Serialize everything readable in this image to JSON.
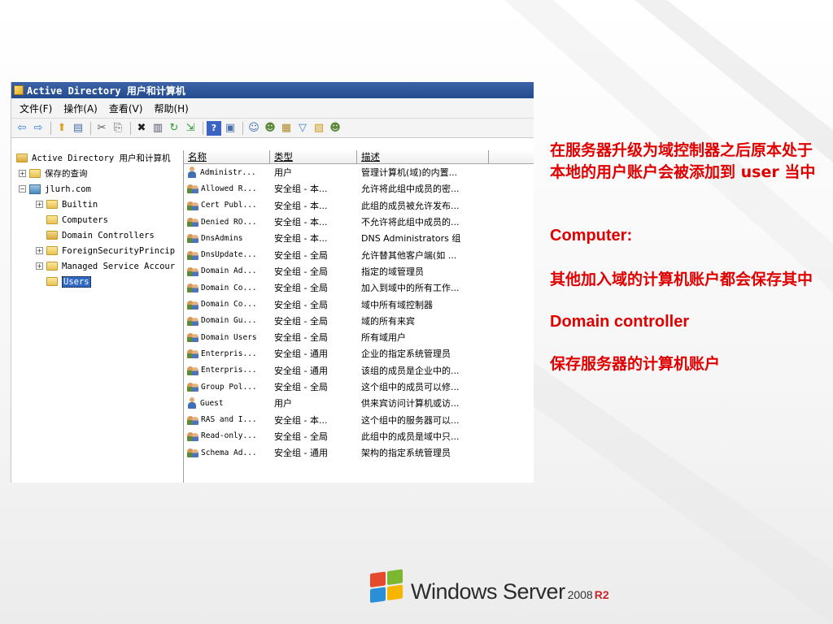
{
  "window": {
    "title": "Active Directory 用户和计算机",
    "menu": [
      "文件(F)",
      "操作(A)",
      "查看(V)",
      "帮助(H)"
    ],
    "toolbar_icons": [
      "back-arrow-icon",
      "forward-arrow-icon",
      "up-folder-icon",
      "show-hide-console-tree-icon",
      "cut-icon",
      "copy-icon",
      "delete-icon",
      "properties-icon",
      "refresh-icon",
      "export-list-icon",
      "help-icon",
      "console-icon",
      "new-user-icon",
      "new-group-icon",
      "new-ou-icon",
      "filter-icon",
      "add-to-group-icon",
      "find-icon"
    ]
  },
  "tree": {
    "root": "Active Directory 用户和计算机",
    "saved_queries": "保存的查询",
    "domain": "jlurh.com",
    "builtin": "Builtin",
    "computers": "Computers",
    "domain_controllers": "Domain Controllers",
    "foreign": "ForeignSecurityPrincip",
    "managed": "Managed Service Accour",
    "users": "Users"
  },
  "list": {
    "headers": {
      "name": "名称",
      "type": "类型",
      "desc": "描述"
    },
    "rows": [
      {
        "icon": "user",
        "name": "Administr...",
        "type": "用户",
        "desc": "管理计算机(域)的内置..."
      },
      {
        "icon": "group",
        "name": "Allowed R...",
        "type": "安全组 - 本...",
        "desc": "允许将此组中成员的密..."
      },
      {
        "icon": "group",
        "name": "Cert Publ...",
        "type": "安全组 - 本...",
        "desc": "此组的成员被允许发布..."
      },
      {
        "icon": "group",
        "name": "Denied RO...",
        "type": "安全组 - 本...",
        "desc": "不允许将此组中成员的..."
      },
      {
        "icon": "group",
        "name": "DnsAdmins",
        "type": "安全组 - 本...",
        "desc": "DNS Administrators 组"
      },
      {
        "icon": "group",
        "name": "DnsUpdate...",
        "type": "安全组 - 全局",
        "desc": "允许替其他客户端(如 ..."
      },
      {
        "icon": "group",
        "name": "Domain Ad...",
        "type": "安全组 - 全局",
        "desc": "指定的域管理员"
      },
      {
        "icon": "group",
        "name": "Domain Co...",
        "type": "安全组 - 全局",
        "desc": "加入到域中的所有工作..."
      },
      {
        "icon": "group",
        "name": "Domain Co...",
        "type": "安全组 - 全局",
        "desc": "域中所有域控制器"
      },
      {
        "icon": "group",
        "name": "Domain Gu...",
        "type": "安全组 - 全局",
        "desc": "域的所有来宾"
      },
      {
        "icon": "group",
        "name": "Domain Users",
        "type": "安全组 - 全局",
        "desc": "所有域用户"
      },
      {
        "icon": "group",
        "name": "Enterpris...",
        "type": "安全组 - 通用",
        "desc": "企业的指定系统管理员"
      },
      {
        "icon": "group",
        "name": "Enterpris...",
        "type": "安全组 - 通用",
        "desc": "该组的成员是企业中的..."
      },
      {
        "icon": "group",
        "name": "Group Pol...",
        "type": "安全组 - 全局",
        "desc": "这个组中的成员可以修..."
      },
      {
        "icon": "user",
        "name": "Guest",
        "type": "用户",
        "desc": "供来宾访问计算机或访..."
      },
      {
        "icon": "group",
        "name": "RAS and I...",
        "type": "安全组 - 本...",
        "desc": "这个组中的服务器可以..."
      },
      {
        "icon": "group",
        "name": "Read-only...",
        "type": "安全组 - 全局",
        "desc": "此组中的成员是域中只..."
      },
      {
        "icon": "group",
        "name": "Schema Ad...",
        "type": "安全组 - 通用",
        "desc": "架构的指定系统管理员"
      }
    ]
  },
  "notes": {
    "p1": "在服务器升级为域控制器之后原本处于本地的用户账户会被添加到 user 当中",
    "h2": "Computer:",
    "p2": "其他加入域的计算机账户都会保存其中",
    "h3": "Domain controller",
    "p3": "保存服务器的计算机账户",
    "color": "#e00000"
  },
  "logo": {
    "word": "Windows Server",
    "version": "2008",
    "release": "R2"
  }
}
